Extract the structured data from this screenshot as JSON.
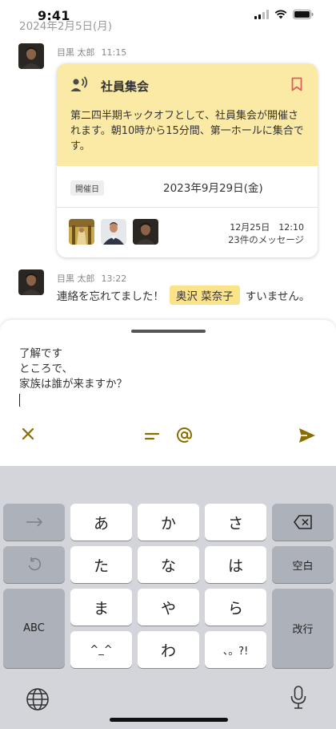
{
  "status": {
    "time": "9:41"
  },
  "date_label": "2024年2月5日(月)",
  "message1": {
    "sender": "目黒 太郎",
    "time": "11:15",
    "card": {
      "title": "社員集会",
      "body": "第二四半期キックオフとして、社員集会が開催されます。朝10時から15分間、第一ホールに集合です。",
      "date_badge": "開催日",
      "date_value": "2023年9月29日(金)",
      "reply_stamp": "12月25日　12:10",
      "reply_count": "23件のメッセージ",
      "icon": "announcement-icon",
      "bookmark_icon": "bookmark-icon"
    }
  },
  "message2": {
    "sender": "目黒 太郎",
    "time": "13:22",
    "text_before": "連絡を忘れてました！",
    "mention": "奥沢 菜奈子",
    "text_after": "すいません。"
  },
  "compose": {
    "lines": [
      "了解です",
      "ところで、",
      "家族は誰が来ますか？"
    ]
  },
  "keyboard": {
    "keys": {
      "a": "あ",
      "ka": "か",
      "sa": "さ",
      "ta": "た",
      "na": "な",
      "ha": "は",
      "ma": "ま",
      "ya": "や",
      "ra": "ら",
      "kao": "^_^",
      "wa": "わ",
      "punct": "、。?!",
      "abc": "ABC",
      "space": "空白",
      "enter": "改行"
    }
  },
  "colors": {
    "accent": "#8a6d00",
    "card_header": "#fbeaa6",
    "mention_bg": "#fbe38a",
    "bookmark": "#e05c5c",
    "keyboard_bg": "#d3d5da"
  }
}
